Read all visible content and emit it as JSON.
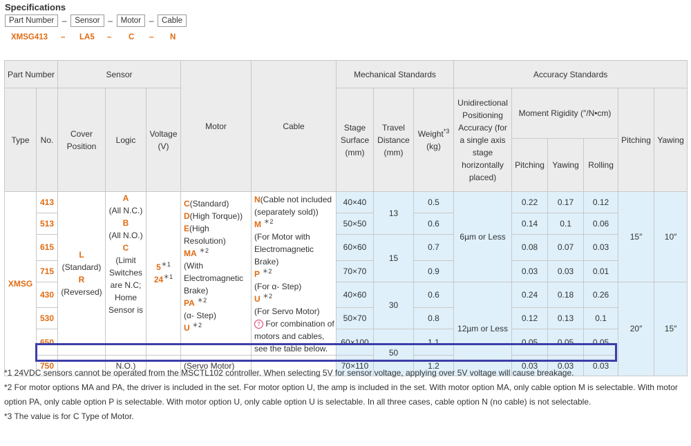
{
  "title": "Specifications",
  "part_number": {
    "labels": [
      "Part Number",
      "Sensor",
      "Motor",
      "Cable"
    ],
    "dash": "–",
    "codes": [
      "XMSG413",
      "LA5",
      "C",
      "N"
    ]
  },
  "headers": {
    "part_number": "Part Number",
    "sensor": "Sensor",
    "motor": "Motor",
    "cable": "Cable",
    "mechanical": "Mechanical Standards",
    "accuracy": "Accuracy Standards",
    "type": "Type",
    "no": "No.",
    "cover_position": "Cover Position",
    "logic": "Logic",
    "voltage": "Voltage (V)",
    "stage_surface": "Stage Surface (mm)",
    "travel_distance": "Travel Distance (mm)",
    "weight": "Weight",
    "weight_note": "*3",
    "weight_unit": "(kg)",
    "unidirectional": "Unidirectional Positioning Accuracy (for a single axis stage horizontally placed)",
    "moment_rigidity": "Moment Rigidity (″/N•cm)",
    "pitching": "Pitching",
    "yawing": "Yawing",
    "rolling": "Rolling",
    "pitching2": "Pitching",
    "yawing2": "Yawing"
  },
  "type": "XMSG",
  "rows": [
    {
      "no": "413",
      "stage": "40×40",
      "weight": "0.5",
      "pitching": "0.22",
      "yawing": "0.17",
      "rolling": "0.12"
    },
    {
      "no": "513",
      "stage": "50×50",
      "weight": "0.6",
      "pitching": "0.14",
      "yawing": "0.1",
      "rolling": "0.06"
    },
    {
      "no": "615",
      "stage": "60×60",
      "weight": "0.7",
      "pitching": "0.08",
      "yawing": "0.07",
      "rolling": "0.03"
    },
    {
      "no": "715",
      "stage": "70×70",
      "weight": "0.9",
      "pitching": "0.03",
      "yawing": "0.03",
      "rolling": "0.01"
    },
    {
      "no": "430",
      "stage": "40×60",
      "weight": "0.6",
      "pitching": "0.24",
      "yawing": "0.18",
      "rolling": "0.26"
    },
    {
      "no": "530",
      "stage": "50×70",
      "weight": "0.8",
      "pitching": "0.12",
      "yawing": "0.13",
      "rolling": "0.1"
    },
    {
      "no": "650",
      "stage": "60×100",
      "weight": "1.1",
      "pitching": "0.05",
      "yawing": "0.05",
      "rolling": "0.05"
    },
    {
      "no": "750",
      "stage": "70×110",
      "weight": "1.2",
      "pitching": "0.03",
      "yawing": "0.03",
      "rolling": "0.03"
    }
  ],
  "travel": [
    "13",
    "15",
    "30",
    "50"
  ],
  "accuracy": [
    "6µm or Less",
    "12µm or Less"
  ],
  "angle_pitching": [
    "15″",
    "20″"
  ],
  "angle_yawing": [
    "10″",
    "15″"
  ],
  "cover": {
    "l_code": "L",
    "l_text": "(Standard)",
    "r_code": "R",
    "r_text": "(Reversed)"
  },
  "logic": {
    "a_code": "A",
    "a_text": "(All N.C.)",
    "b_code": "B",
    "b_text": "(All N.O.)",
    "c_code": "C",
    "c_text": "(Limit Switches are N.C; Home Sensor is",
    "last_text": "N.O.)"
  },
  "voltage": {
    "v1": "5",
    "v1_note": "＊1",
    "v2": "24",
    "v2_note": "＊1"
  },
  "motor": {
    "c_code": "C",
    "c_text": "(Standard)",
    "d_code": "D",
    "d_text": "(High Torque))",
    "e_code": "E",
    "e_text": "(High Resolution)",
    "ma_code": "MA",
    "ma_note": "＊2",
    "ma_text": "(With Electromagnetic Brake)",
    "pa_code": "PA",
    "pa_note": "＊2",
    "pa_text": "(α- Step)",
    "u_code": "U",
    "u_note": "＊2",
    "u_text": "(Servo Motor)"
  },
  "cable": {
    "n_code": "N",
    "n_text": "(Cable not included (separately sold))",
    "m_code": "M",
    "m_note": "＊2",
    "m_text": "(For Motor with Electromagnetic Brake)",
    "p_code": "P",
    "p_note": "＊2",
    "p_text": "(For α- Step)",
    "u_code": "U",
    "u_note": "＊2",
    "u_text": "(For Servo Motor)",
    "combo_text": "For combination of motors and cables, see the table below."
  },
  "notes": [
    "*1 24VDC sensors cannot be operated from the MSCTL102 controller. When selecting 5V for sensor voltage, applying over 5V voltage will cause breakage.",
    "*2 For motor options MA and PA, the driver is included in the set. For motor option U, the amp is included in the set. With motor option MA, only cable option M is selectable. With motor option PA, only cable option P is selectable. With motor option U, only cable option U is selectable. In all three cases, cable option N (no cable) is not selectable.",
    "*3 The value is for C Type of Motor."
  ],
  "colors": {
    "accent": "#e06b12",
    "header_bg": "#ececec",
    "blue_cell": "#dff0fa",
    "highlight": "#3b3ea8"
  }
}
